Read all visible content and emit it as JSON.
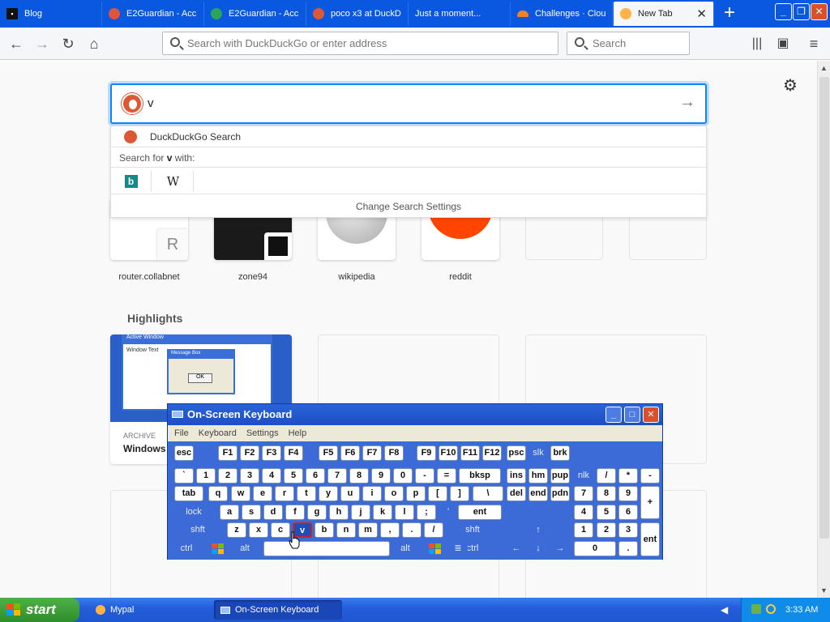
{
  "browser": {
    "tabs": [
      {
        "label": "Blog",
        "icon": "terminal-icon"
      },
      {
        "label": "E2Guardian - Acc",
        "icon": "e2guardian-icon"
      },
      {
        "label": "E2Guardian - Acc",
        "icon": "e2guardian-green-icon"
      },
      {
        "label": "poco x3 at DuckD",
        "icon": "duckduckgo-icon"
      },
      {
        "label": "Just a moment...",
        "icon": ""
      },
      {
        "label": "Challenges · Clou",
        "icon": "cloudflare-icon"
      },
      {
        "label": "New Tab",
        "icon": "firefox-icon"
      }
    ],
    "url_placeholder": "Search with DuckDuckGo or enter address",
    "search_placeholder": "Search"
  },
  "newtab": {
    "query": "v",
    "dropdown": {
      "engine_label": "DuckDuckGo Search",
      "search_for_prefix": "Search for",
      "search_for_term": "v",
      "search_for_suffix": "with:",
      "engines": [
        "Bing",
        "W"
      ],
      "change_settings": "Change Search Settings"
    },
    "top_sites": [
      {
        "name": "router.collabnet",
        "badge": "R"
      },
      {
        "name": "zone94"
      },
      {
        "name": "wikipedia"
      },
      {
        "name": "reddit"
      }
    ],
    "highlights_title": "Highlights",
    "highlight": {
      "type": "ARCHIVE",
      "title": "Windows",
      "shot_title": "Active Window",
      "shot_sub": "Window Text",
      "shot_box": "Message Box",
      "shot_ok": "OK"
    }
  },
  "osk": {
    "title": "On-Screen Keyboard",
    "menu": [
      "File",
      "Keyboard",
      "Settings",
      "Help"
    ],
    "rows": {
      "fn": [
        "esc",
        "F1",
        "F2",
        "F3",
        "F4",
        "F5",
        "F6",
        "F7",
        "F8",
        "F9",
        "F10",
        "F11",
        "F12",
        "psc",
        "slk",
        "brk"
      ],
      "num": [
        "`",
        "1",
        "2",
        "3",
        "4",
        "5",
        "6",
        "7",
        "8",
        "9",
        "0",
        "-",
        "=",
        "bksp",
        "ins",
        "hm",
        "pup",
        "nlk",
        "/",
        "*",
        "-"
      ],
      "top": [
        "tab",
        "q",
        "w",
        "e",
        "r",
        "t",
        "y",
        "u",
        "i",
        "o",
        "p",
        "[",
        "]",
        "\\",
        "del",
        "end",
        "pdn",
        "7",
        "8",
        "9",
        "+"
      ],
      "home": [
        "lock",
        "a",
        "s",
        "d",
        "f",
        "g",
        "h",
        "j",
        "k",
        "l",
        ";",
        "'",
        "ent",
        "4",
        "5",
        "6"
      ],
      "bottom": [
        "shft",
        "z",
        "x",
        "c",
        "v",
        "b",
        "n",
        "m",
        ",",
        ".",
        "/",
        "shft",
        "↑",
        "1",
        "2",
        "3",
        "ent"
      ],
      "space": [
        "ctrl",
        "alt",
        "alt",
        "ctrl",
        "←",
        "↓",
        "→",
        "0",
        "."
      ]
    }
  },
  "taskbar": {
    "start": "start",
    "tasks": [
      "Mypal",
      "On-Screen Keyboard"
    ],
    "clock": "3:33 AM"
  }
}
